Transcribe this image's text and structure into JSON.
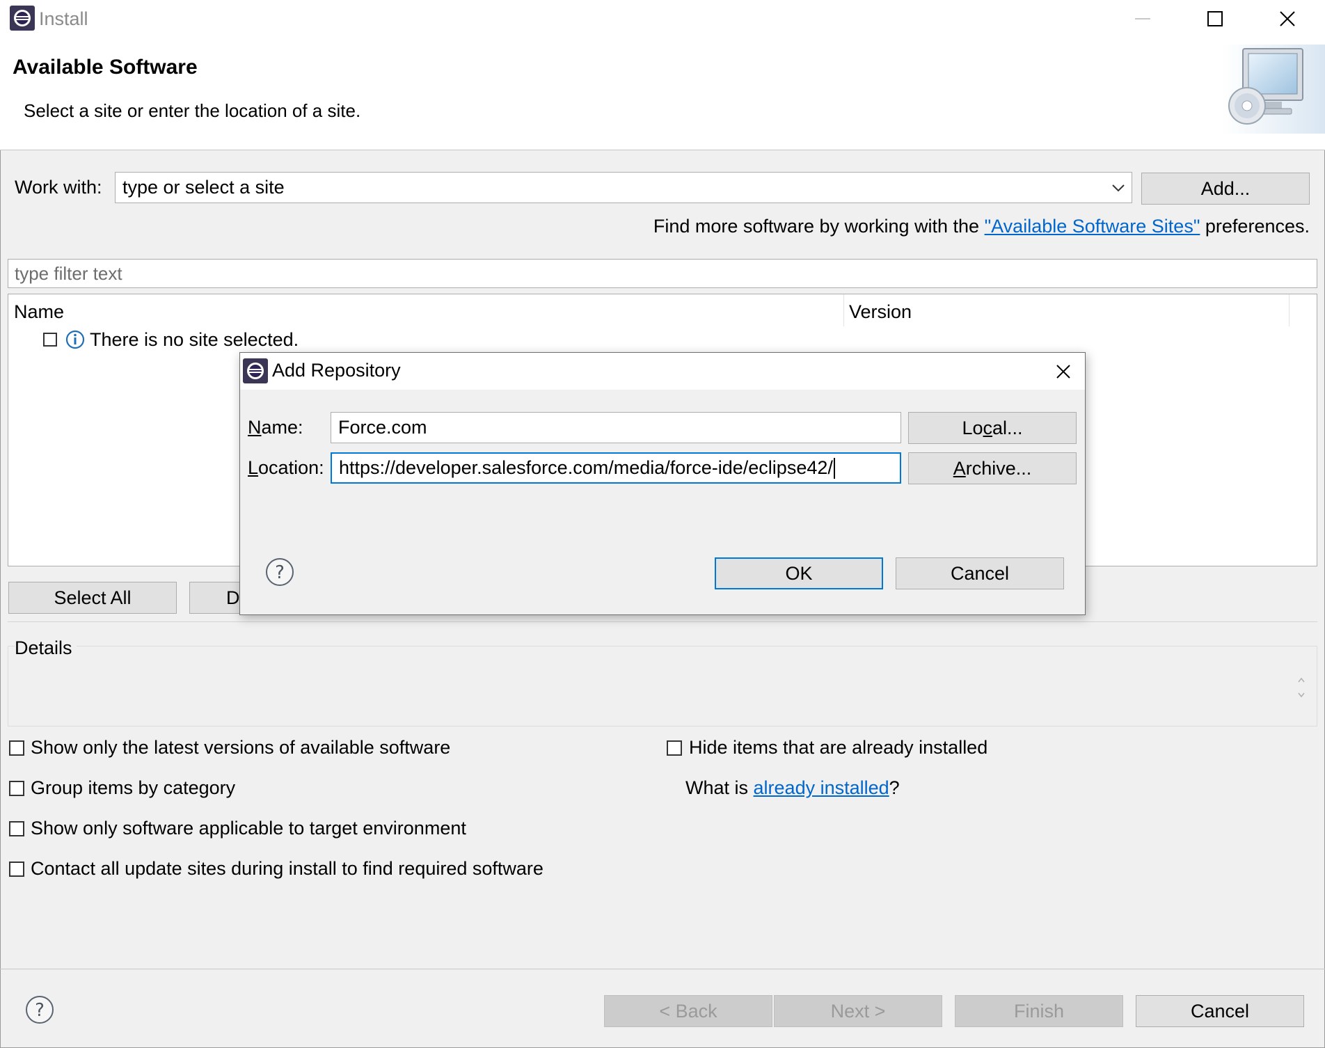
{
  "window": {
    "title": "Install",
    "icon": "eclipse-icon",
    "controls": [
      "minimize-icon",
      "maximize-icon",
      "close-icon"
    ]
  },
  "header": {
    "title": "Available Software",
    "subtitle": "Select a site or enter the location of a site.",
    "graphic": "computer-cd-icon"
  },
  "work_with": {
    "label": "Work with:",
    "placeholder": "type or select a site",
    "add_button": "Add..."
  },
  "find_more": {
    "prefix": "Find more software by working with the ",
    "link": "\"Available Software Sites\"",
    "suffix": " preferences."
  },
  "filter": {
    "placeholder": "type filter text"
  },
  "table": {
    "columns": [
      "Name",
      "Version"
    ],
    "rows": [
      {
        "checked": false,
        "icon": "info-icon",
        "name": "There is no site selected.",
        "version": ""
      }
    ]
  },
  "selection_buttons": {
    "select_all": "Select All",
    "deselect_all_visible": "D"
  },
  "details": {
    "label": "Details"
  },
  "options": {
    "show_latest": {
      "label": "Show only the latest versions of available software",
      "checked": false
    },
    "group_by_category": {
      "label": "Group items by category",
      "checked": false
    },
    "target_env": {
      "label": "Show only software applicable to target environment",
      "checked": false
    },
    "contact_all": {
      "label": "Contact all update sites during install to find required software",
      "checked": false
    },
    "hide_installed": {
      "label": "Hide items that are already installed",
      "checked": false
    },
    "what_is": {
      "prefix": "What is ",
      "link": "already installed",
      "suffix": "?"
    }
  },
  "footer": {
    "back": "< Back",
    "next": "Next >",
    "finish": "Finish",
    "cancel": "Cancel",
    "help_icon": "help-icon"
  },
  "dialog": {
    "title": "Add Repository",
    "icon": "eclipse-icon",
    "name_label": "Name:",
    "name_value": "Force.com",
    "location_label": "Location:",
    "location_value": "https://developer.salesforce.com/media/force-ide/eclipse42/",
    "local_button": "Local...",
    "archive_button": "Archive...",
    "ok_button": "OK",
    "cancel_button": "Cancel",
    "help_icon": "help-icon"
  },
  "colors": {
    "link": "#0066cc",
    "focus_border": "#0078d7",
    "window_bg": "#f0f0f0"
  }
}
